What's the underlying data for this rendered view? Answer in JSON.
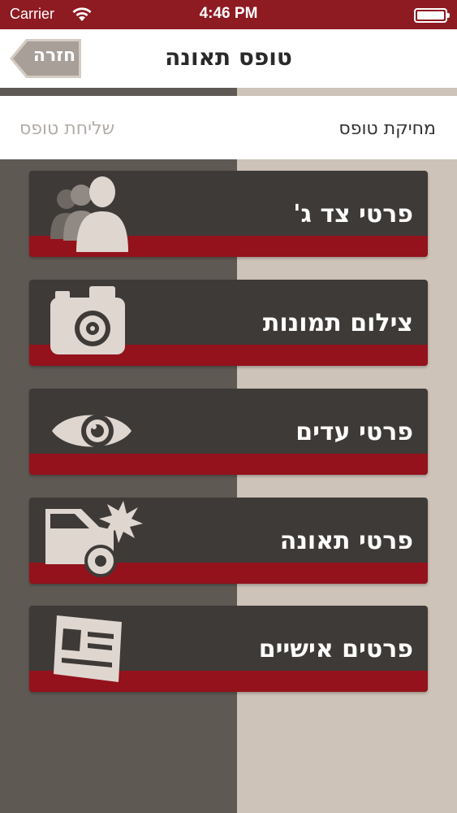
{
  "status_bar": {
    "carrier": "Carrier",
    "time": "4:46 PM"
  },
  "nav": {
    "title": "טופס תאונה",
    "back_label": "חזרה"
  },
  "actions": {
    "delete_label": "מחיקת טופס",
    "send_label": "שליחת טופס"
  },
  "menu": {
    "items": [
      {
        "label": "פרטי צד ג'",
        "icon": "people-icon"
      },
      {
        "label": "צילום תמונות",
        "icon": "camera-icon"
      },
      {
        "label": "פרטי עדים",
        "icon": "eye-icon"
      },
      {
        "label": "פרטי תאונה",
        "icon": "car-crash-icon"
      },
      {
        "label": "פרטים אישיים",
        "icon": "id-card-icon"
      }
    ]
  },
  "colors": {
    "brand_red": "#93121c",
    "status_bar": "#8e1a22",
    "card": "#3e3a37",
    "panel_dark": "#5f5954",
    "panel_light": "#cec3b8",
    "icon_fill": "#ded6cf"
  }
}
